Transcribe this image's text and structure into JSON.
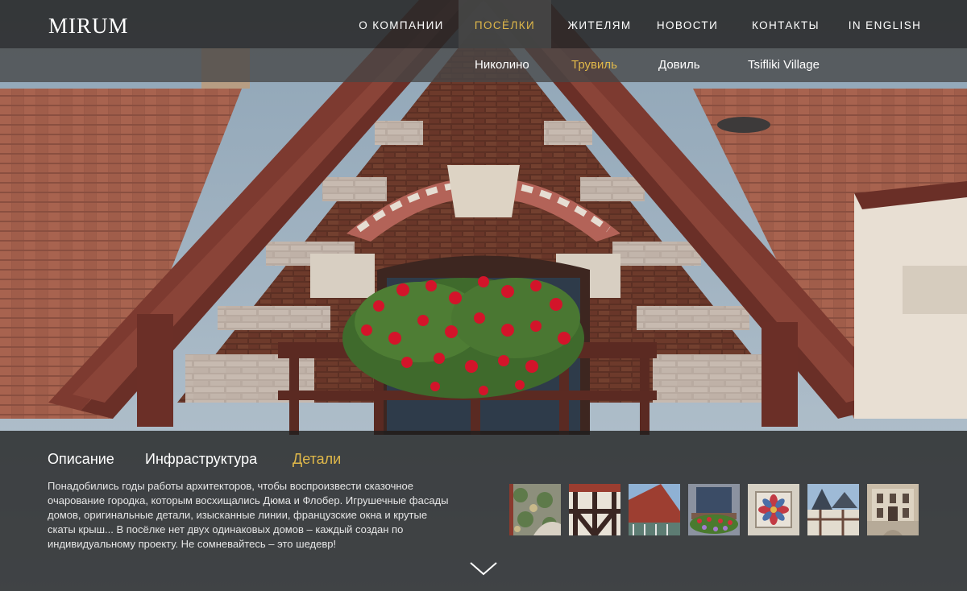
{
  "header": {
    "logo": "MIRUM",
    "nav": [
      {
        "label": "О КОМПАНИИ",
        "active": false
      },
      {
        "label": "ПОСЁЛКИ",
        "active": true
      },
      {
        "label": "ЖИТЕЛЯМ",
        "active": false
      },
      {
        "label": "НОВОСТИ",
        "active": false
      },
      {
        "label": "КОНТАКТЫ",
        "active": false
      },
      {
        "label": "IN ENGLISH",
        "active": false
      }
    ]
  },
  "subnav": [
    {
      "label": "Николино",
      "active": false
    },
    {
      "label": "Трувиль",
      "active": true
    },
    {
      "label": "Довиль",
      "active": false
    },
    {
      "label": "Tsifliki Village",
      "active": false
    }
  ],
  "panel": {
    "tabs": [
      {
        "label": "Описание",
        "active": false
      },
      {
        "label": "Инфраструктура",
        "active": false
      },
      {
        "label": "Детали",
        "active": true
      }
    ],
    "description": "Понадобились годы работы архитекторов, чтобы воспроизвести сказочное очарование городка, которым восхищались Дюма и Флобер. Игрушечные фасады домов, оригинальные детали, изысканные линии, французские окна и крутые скаты крыш... В посёлке нет двух одинаковых домов – каждый создан по индивидуальному проекту. Не сомневайтесь – это шедевр!",
    "thumbnails": [
      "mosaic-tile",
      "half-timber-wall",
      "red-roof-gable",
      "flower-window",
      "decorative-tile",
      "turret-roofs",
      "courtyard-facade"
    ],
    "scroll_icon": "chevron-down-icon"
  },
  "colors": {
    "accent": "#e0b84a",
    "nav_bg": "#282828",
    "text": "#ffffff"
  }
}
